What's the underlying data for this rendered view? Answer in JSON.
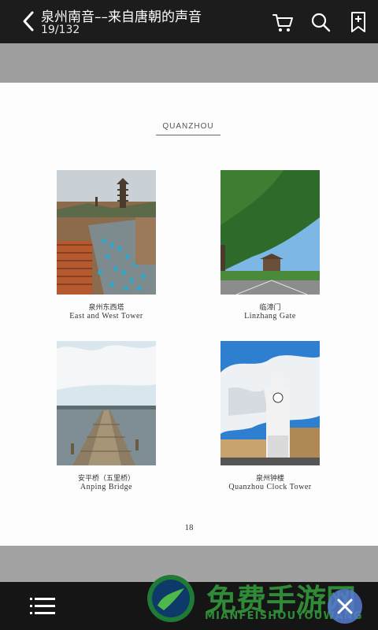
{
  "header": {
    "title": "泉州南音––来自唐朝的声音",
    "page_indicator": "19/132",
    "icons": [
      "back-icon",
      "cart-icon",
      "search-icon",
      "bookmark-add-icon"
    ]
  },
  "page": {
    "section_heading": "QUANZHOU",
    "page_number": "18",
    "photos": [
      {
        "caption_cn": "泉州东西塔",
        "caption_en": "East and West Tower"
      },
      {
        "caption_cn": "临漳门",
        "caption_en": "Linzhang Gate"
      },
      {
        "caption_cn": "安平桥（五里桥）",
        "caption_en": "Anping Bridge"
      },
      {
        "caption_cn": "泉州钟楼",
        "caption_en": "Quanzhou Clock Tower"
      }
    ]
  },
  "bottom": {
    "icons": [
      "menu-icon",
      "close-icon"
    ],
    "watermark_cn": "免费手游网",
    "watermark_en": "MIANFEISHOUYOUWANG"
  },
  "colors": {
    "topbar": "#1c1c1c",
    "page": "#fdfdfd",
    "watermark": "#2f8b37",
    "fab": "#587ad2"
  }
}
